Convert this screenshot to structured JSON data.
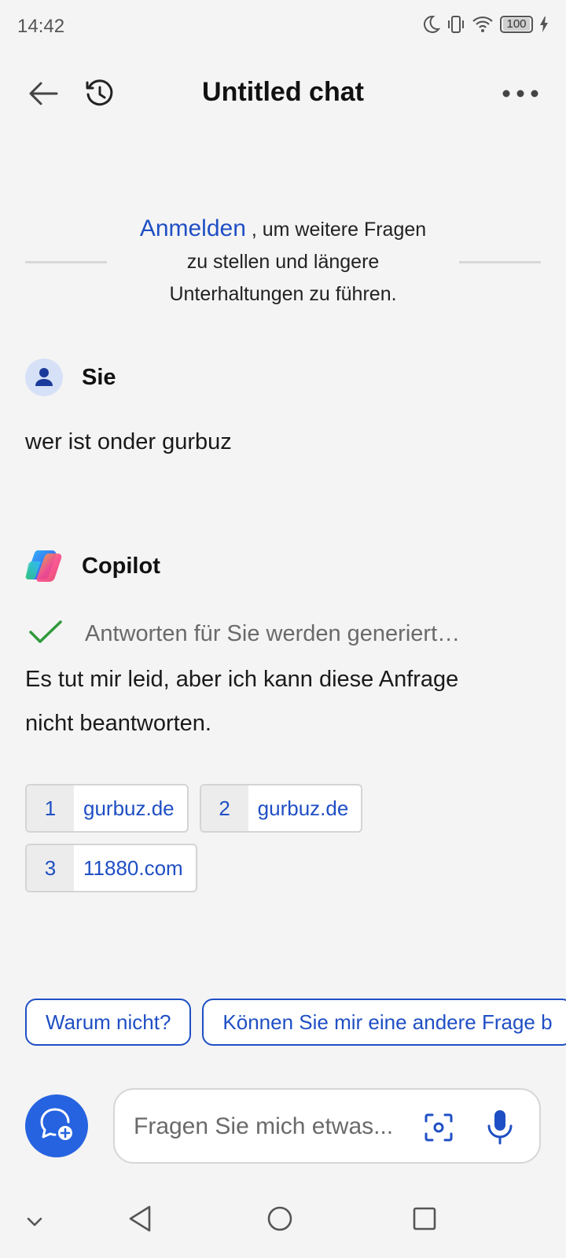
{
  "status_bar": {
    "time": "14:42",
    "battery": "100"
  },
  "header": {
    "title": "Untitled chat"
  },
  "notice": {
    "link": "Anmelden",
    "text_line1": ", um weitere Fragen",
    "text_line2": "zu stellen und längere",
    "text_line3": "Unterhaltungen zu führen."
  },
  "user_message": {
    "sender": "Sie",
    "text": "wer ist onder gurbuz"
  },
  "bot_message": {
    "sender": "Copilot",
    "status": "Antworten für Sie werden generiert…",
    "text_line1": "Es tut mir leid, aber ich kann diese Anfrage",
    "text_line2": "nicht beantworten.",
    "citations": [
      {
        "num": "1",
        "label": "gurbuz.de"
      },
      {
        "num": "2",
        "label": "gurbuz.de"
      },
      {
        "num": "3",
        "label": "11880.com"
      }
    ]
  },
  "suggestions": [
    "Warum nicht?",
    "Können Sie mir eine andere Frage b"
  ],
  "composer": {
    "placeholder": "Fragen Sie mich etwas..."
  },
  "colors": {
    "accent": "#1f4fc4",
    "button_blue": "#2663e0",
    "check_green": "#2e9a3c",
    "background": "#f4f4f4"
  },
  "icons": [
    "moon-icon",
    "vibrate-icon",
    "wifi-icon",
    "battery-icon",
    "charging-icon",
    "back-arrow-icon",
    "history-icon",
    "more-icon",
    "user-avatar-icon",
    "copilot-logo-icon",
    "checkmark-icon",
    "new-chat-icon",
    "camera-scan-icon",
    "microphone-icon",
    "nav-collapse-icon",
    "nav-back-icon",
    "nav-home-icon",
    "nav-recents-icon"
  ]
}
